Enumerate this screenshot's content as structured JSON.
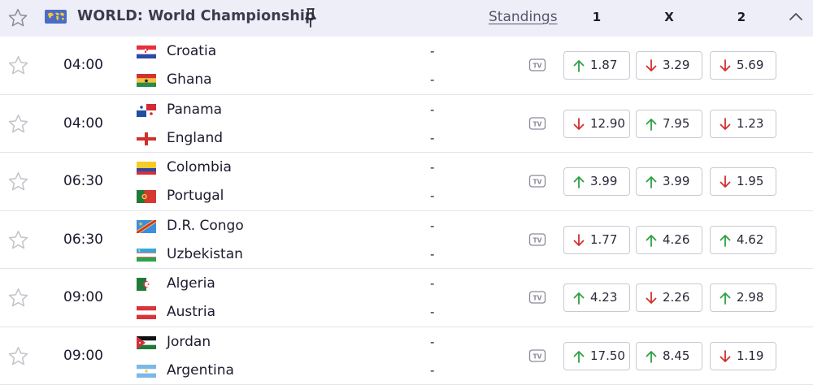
{
  "header": {
    "title": "WORLD: World Championship",
    "standings_label": "Standings",
    "col_1": "1",
    "col_x": "X",
    "col_2": "2",
    "favorite_icon": "star-outline-icon",
    "flag_icon": "world-flag-icon",
    "pin_icon": "pin-icon",
    "collapse_icon": "chevron-up-icon"
  },
  "colors": {
    "header_bg": "#eeeef9",
    "odds_up": "#2ea043",
    "odds_down": "#d0312d",
    "border": "#c9c9d3"
  },
  "matches": [
    {
      "time": "04:00",
      "home": {
        "name": "Croatia",
        "flag": "croatia-flag-icon",
        "score": "-"
      },
      "away": {
        "name": "Ghana",
        "flag": "ghana-flag-icon",
        "score": "-"
      },
      "odds": [
        {
          "value": "1.87",
          "trend": "up"
        },
        {
          "value": "3.29",
          "trend": "down"
        },
        {
          "value": "5.69",
          "trend": "down"
        }
      ]
    },
    {
      "time": "04:00",
      "home": {
        "name": "Panama",
        "flag": "panama-flag-icon",
        "score": "-"
      },
      "away": {
        "name": "England",
        "flag": "england-flag-icon",
        "score": "-"
      },
      "odds": [
        {
          "value": "12.90",
          "trend": "down"
        },
        {
          "value": "7.95",
          "trend": "up"
        },
        {
          "value": "1.23",
          "trend": "down"
        }
      ]
    },
    {
      "time": "06:30",
      "home": {
        "name": "Colombia",
        "flag": "colombia-flag-icon",
        "score": "-"
      },
      "away": {
        "name": "Portugal",
        "flag": "portugal-flag-icon",
        "score": "-"
      },
      "odds": [
        {
          "value": "3.99",
          "trend": "up"
        },
        {
          "value": "3.99",
          "trend": "up"
        },
        {
          "value": "1.95",
          "trend": "down"
        }
      ]
    },
    {
      "time": "06:30",
      "home": {
        "name": "D.R. Congo",
        "flag": "dr-congo-flag-icon",
        "score": "-"
      },
      "away": {
        "name": "Uzbekistan",
        "flag": "uzbekistan-flag-icon",
        "score": "-"
      },
      "odds": [
        {
          "value": "1.77",
          "trend": "down"
        },
        {
          "value": "4.26",
          "trend": "up"
        },
        {
          "value": "4.62",
          "trend": "up"
        }
      ]
    },
    {
      "time": "09:00",
      "home": {
        "name": "Algeria",
        "flag": "algeria-flag-icon",
        "score": "-"
      },
      "away": {
        "name": "Austria",
        "flag": "austria-flag-icon",
        "score": "-"
      },
      "odds": [
        {
          "value": "4.23",
          "trend": "up"
        },
        {
          "value": "2.26",
          "trend": "down"
        },
        {
          "value": "2.98",
          "trend": "up"
        }
      ]
    },
    {
      "time": "09:00",
      "home": {
        "name": "Jordan",
        "flag": "jordan-flag-icon",
        "score": "-"
      },
      "away": {
        "name": "Argentina",
        "flag": "argentina-flag-icon",
        "score": "-"
      },
      "odds": [
        {
          "value": "17.50",
          "trend": "up"
        },
        {
          "value": "8.45",
          "trend": "up"
        },
        {
          "value": "1.19",
          "trend": "down"
        }
      ]
    }
  ]
}
